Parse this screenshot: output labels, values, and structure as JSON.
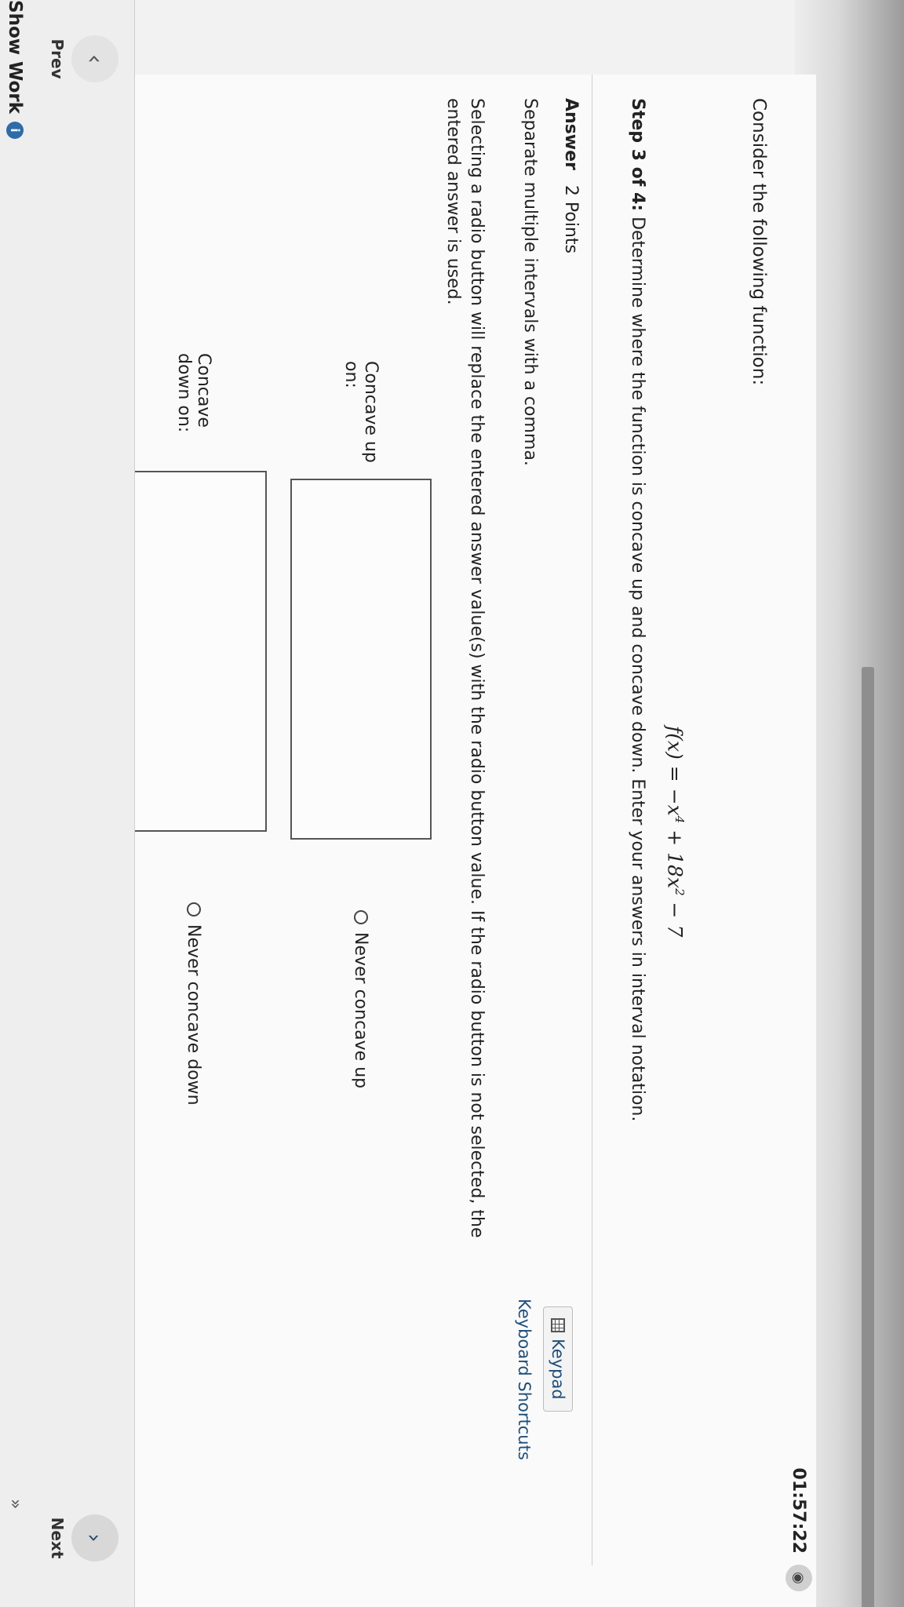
{
  "header": {
    "timer": "01:57:22",
    "eye_icon": "eye-slash-icon"
  },
  "question": {
    "prompt": "Consider the following function:",
    "formula": {
      "lhs": "f(x) = −x",
      "exp1": "4",
      "mid": " + 18x",
      "exp2": "2",
      "rhs": " − 7"
    },
    "step_label": "Step 3 of 4:",
    "step_text": " Determine where the function is concave up and concave down. Enter your answers in interval notation."
  },
  "answer": {
    "label": "Answer",
    "points": "2 Points",
    "keypad_label": "Keypad",
    "shortcuts_label": "Keyboard Shortcuts",
    "instruction_separate": "Separate multiple intervals with a comma.",
    "instruction_radio": "Selecting a radio button will replace the entered answer value(s) with the radio button value. If the radio button is not selected, the entered answer is used.",
    "concave_up_label": "Concave up on:",
    "concave_up_value": "",
    "never_concave_up": "Never concave up",
    "concave_down_label": "Concave down on:",
    "concave_down_value": "",
    "never_concave_down": "Never concave down"
  },
  "nav": {
    "prev_label": "Prev",
    "next_label": "Next",
    "show_work_label": "Show Work",
    "prev_icon": "chevron-left-icon",
    "next_icon": "chevron-right-icon",
    "expand_icon": "double-chevron-right-icon"
  }
}
